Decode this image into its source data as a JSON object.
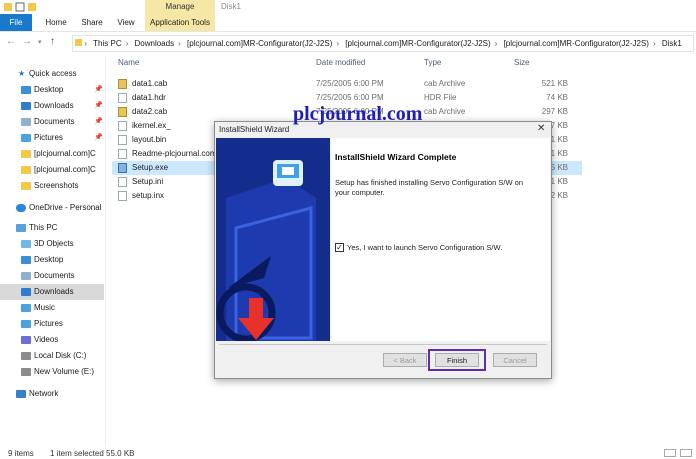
{
  "window": {
    "title": "Disk1"
  },
  "ribbon": {
    "file": "File",
    "home": "Home",
    "share": "Share",
    "view": "View",
    "manage": "Manage",
    "app_tools": "Application Tools"
  },
  "address": {
    "crumbs": [
      "This PC",
      "Downloads",
      "[plcjournal.com]MR-Configurator(J2-J2S)",
      "[plcjournal.com]MR-Configurator(J2-J2S)",
      "[plcjournal.com]MR-Configurator(J2-J2S)",
      "Disk1"
    ]
  },
  "sidebar": {
    "quick_access": "Quick access",
    "items": [
      "Desktop",
      "Downloads",
      "Documents",
      "Pictures",
      "[plcjournal.com]C",
      "[plcjournal.com]C",
      "Screenshots"
    ],
    "onedrive": "OneDrive - Personal",
    "this_pc": "This PC",
    "pc_items": [
      "3D Objects",
      "Desktop",
      "Documents",
      "Downloads",
      "Music",
      "Pictures",
      "Videos",
      "Local Disk (C:)",
      "New Volume (E:)"
    ],
    "network": "Network"
  },
  "columns": {
    "name": "Name",
    "date": "Date modified",
    "type": "Type",
    "size": "Size"
  },
  "files": [
    {
      "name": "data1.cab",
      "date": "7/25/2005 6:00 PM",
      "type": "cab Archive",
      "size": "521 KB"
    },
    {
      "name": "data1.hdr",
      "date": "7/25/2005 6:00 PM",
      "type": "HDR File",
      "size": "74 KB"
    },
    {
      "name": "data2.cab",
      "date": "7/25/2005 6:00 PM",
      "type": "cab Archive",
      "size": "297 KB"
    },
    {
      "name": "ikernel.ex_",
      "date": "",
      "type": "",
      "size": "7 KB"
    },
    {
      "name": "layout.bin",
      "date": "",
      "type": "",
      "size": "1 KB"
    },
    {
      "name": "Readme-plcjournal.com",
      "date": "",
      "type": "",
      "size": "1 KB"
    },
    {
      "name": "Setup.exe",
      "date": "",
      "type": "",
      "size": "5 KB"
    },
    {
      "name": "Setup.ini",
      "date": "",
      "type": "",
      "size": "1 KB"
    },
    {
      "name": "setup.inx",
      "date": "",
      "type": "",
      "size": "2 KB"
    }
  ],
  "status": {
    "count": "9 items",
    "selected": "1 item selected  55.0 KB"
  },
  "watermark": "plcjournal.com",
  "wizard": {
    "title": "InstallShield Wizard",
    "heading": "InstallShield Wizard Complete",
    "body": "Setup has finished installing Servo Configuration S/W on your computer.",
    "checkbox": "Yes, I want to launch Servo Configuration S/W.",
    "back": "< Back",
    "finish": "Finish",
    "cancel": "Cancel"
  },
  "colors": {
    "accent": "#1979ca",
    "manage": "#f6e7a6",
    "banner": "#142c8c",
    "highlight": "#5c2fa7",
    "arrow": "#e8312a"
  }
}
